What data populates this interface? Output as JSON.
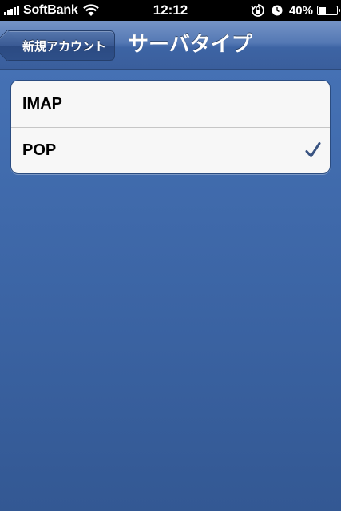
{
  "status_bar": {
    "carrier": "SoftBank",
    "time": "12:12",
    "battery_text": "40%",
    "battery_level": 0.4,
    "icons": [
      "signal-icon",
      "wifi-icon",
      "rotation-lock-icon",
      "alarm-icon",
      "battery-icon"
    ]
  },
  "nav": {
    "back_label": "新規アカウント",
    "title": "サーバタイプ"
  },
  "server_types": [
    {
      "label": "IMAP",
      "selected": false
    },
    {
      "label": "POP",
      "selected": true
    }
  ],
  "colors": {
    "background": "#3e68a8",
    "checkmark": "#3a5482"
  }
}
